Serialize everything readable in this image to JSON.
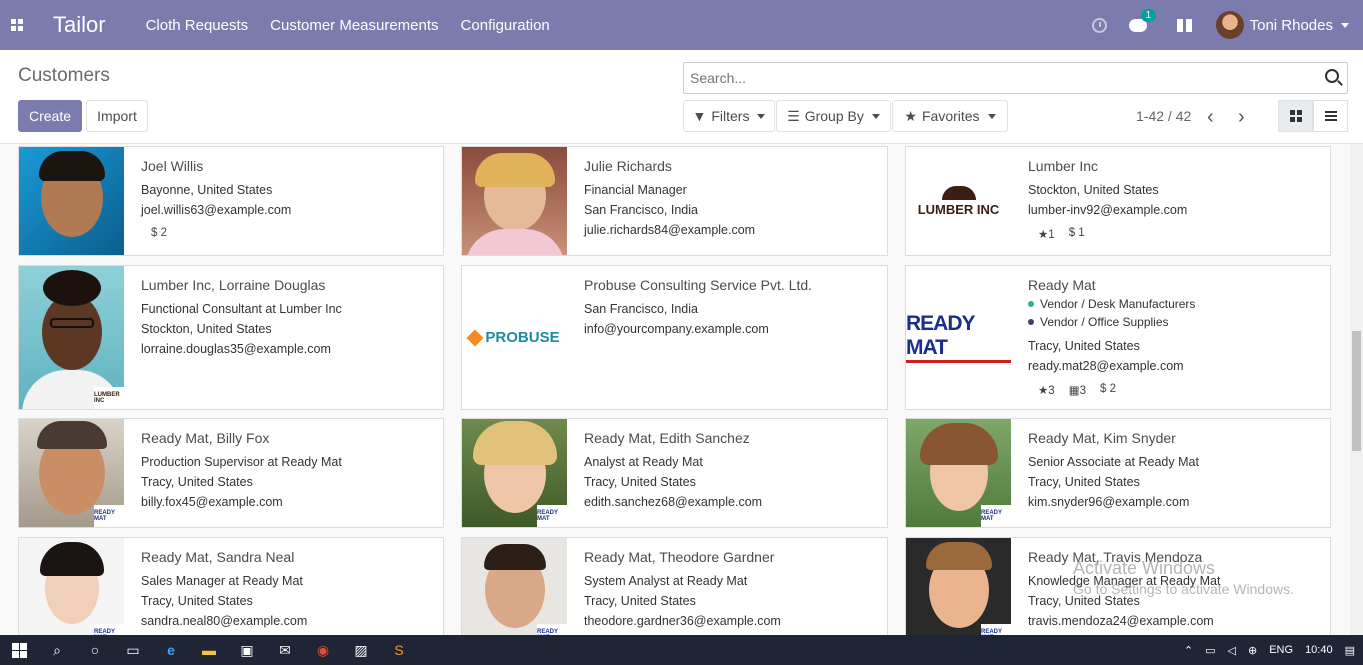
{
  "navbar": {
    "app_name": "Tailor",
    "menu": [
      "Cloth Requests",
      "Customer Measurements",
      "Configuration"
    ],
    "chat_badge": "1",
    "user_name": "Toni Rhodes"
  },
  "control": {
    "title": "Customers",
    "create_label": "Create",
    "import_label": "Import",
    "search_placeholder": "Search...",
    "filters_label": "Filters",
    "groupby_label": "Group By",
    "favorites_label": "Favorites",
    "pager": "1-42 / 42"
  },
  "cards": [
    {
      "name": "Joel Willis",
      "lines": [
        "Bayonne, United States",
        "joel.willis63@example.com"
      ],
      "stats": [
        "$ 2"
      ]
    },
    {
      "name": "Julie Richards",
      "lines": [
        "Financial Manager",
        "San Francisco, India",
        "julie.richards84@example.com"
      ]
    },
    {
      "name": "Lumber Inc",
      "lines": [
        "Stockton, United States",
        "lumber-inv92@example.com"
      ],
      "stats": [
        "★1",
        "$ 1"
      ],
      "logo": "LUMBER INC"
    },
    {
      "name": "Lumber Inc, Lorraine Douglas",
      "lines": [
        "Functional Consultant at Lumber Inc",
        "Stockton, United States",
        "lorraine.douglas35@example.com"
      ]
    },
    {
      "name": "Probuse Consulting Service Pvt. Ltd.",
      "lines": [
        "San Francisco, India",
        "info@yourcompany.example.com"
      ],
      "logo": "PROBUSE"
    },
    {
      "name": "Ready Mat",
      "tags": [
        "Vendor / Desk Manufacturers",
        "Vendor / Office Supplies"
      ],
      "lines": [
        "Tracy, United States",
        "ready.mat28@example.com"
      ],
      "stats": [
        "★3",
        "▦3",
        "$ 2"
      ],
      "logo": "READY MAT"
    },
    {
      "name": "Ready Mat, Billy Fox",
      "lines": [
        "Production Supervisor at Ready Mat",
        "Tracy, United States",
        "billy.fox45@example.com"
      ]
    },
    {
      "name": "Ready Mat, Edith Sanchez",
      "lines": [
        "Analyst at Ready Mat",
        "Tracy, United States",
        "edith.sanchez68@example.com"
      ]
    },
    {
      "name": "Ready Mat, Kim Snyder",
      "lines": [
        "Senior Associate at Ready Mat",
        "Tracy, United States",
        "kim.snyder96@example.com"
      ]
    },
    {
      "name": "Ready Mat, Sandra Neal",
      "lines": [
        "Sales Manager at Ready Mat",
        "Tracy, United States",
        "sandra.neal80@example.com"
      ]
    },
    {
      "name": "Ready Mat, Theodore Gardner",
      "lines": [
        "System Analyst at Ready Mat",
        "Tracy, United States",
        "theodore.gardner36@example.com"
      ]
    },
    {
      "name": "Ready Mat, Travis Mendoza",
      "lines": [
        "Knowledge Manager at Ready Mat",
        "Tracy, United States",
        "travis.mendoza24@example.com"
      ]
    }
  ],
  "mini_logo": "READY MAT",
  "mini_logo_lumber": "LUMBER INC",
  "tag_colors": [
    "#28b47e",
    "#3a4566"
  ],
  "watermark": {
    "line1": "Activate Windows",
    "line2": "Go to Settings to activate Windows."
  },
  "taskbar": {
    "lang": "ENG",
    "time": "10:40"
  }
}
